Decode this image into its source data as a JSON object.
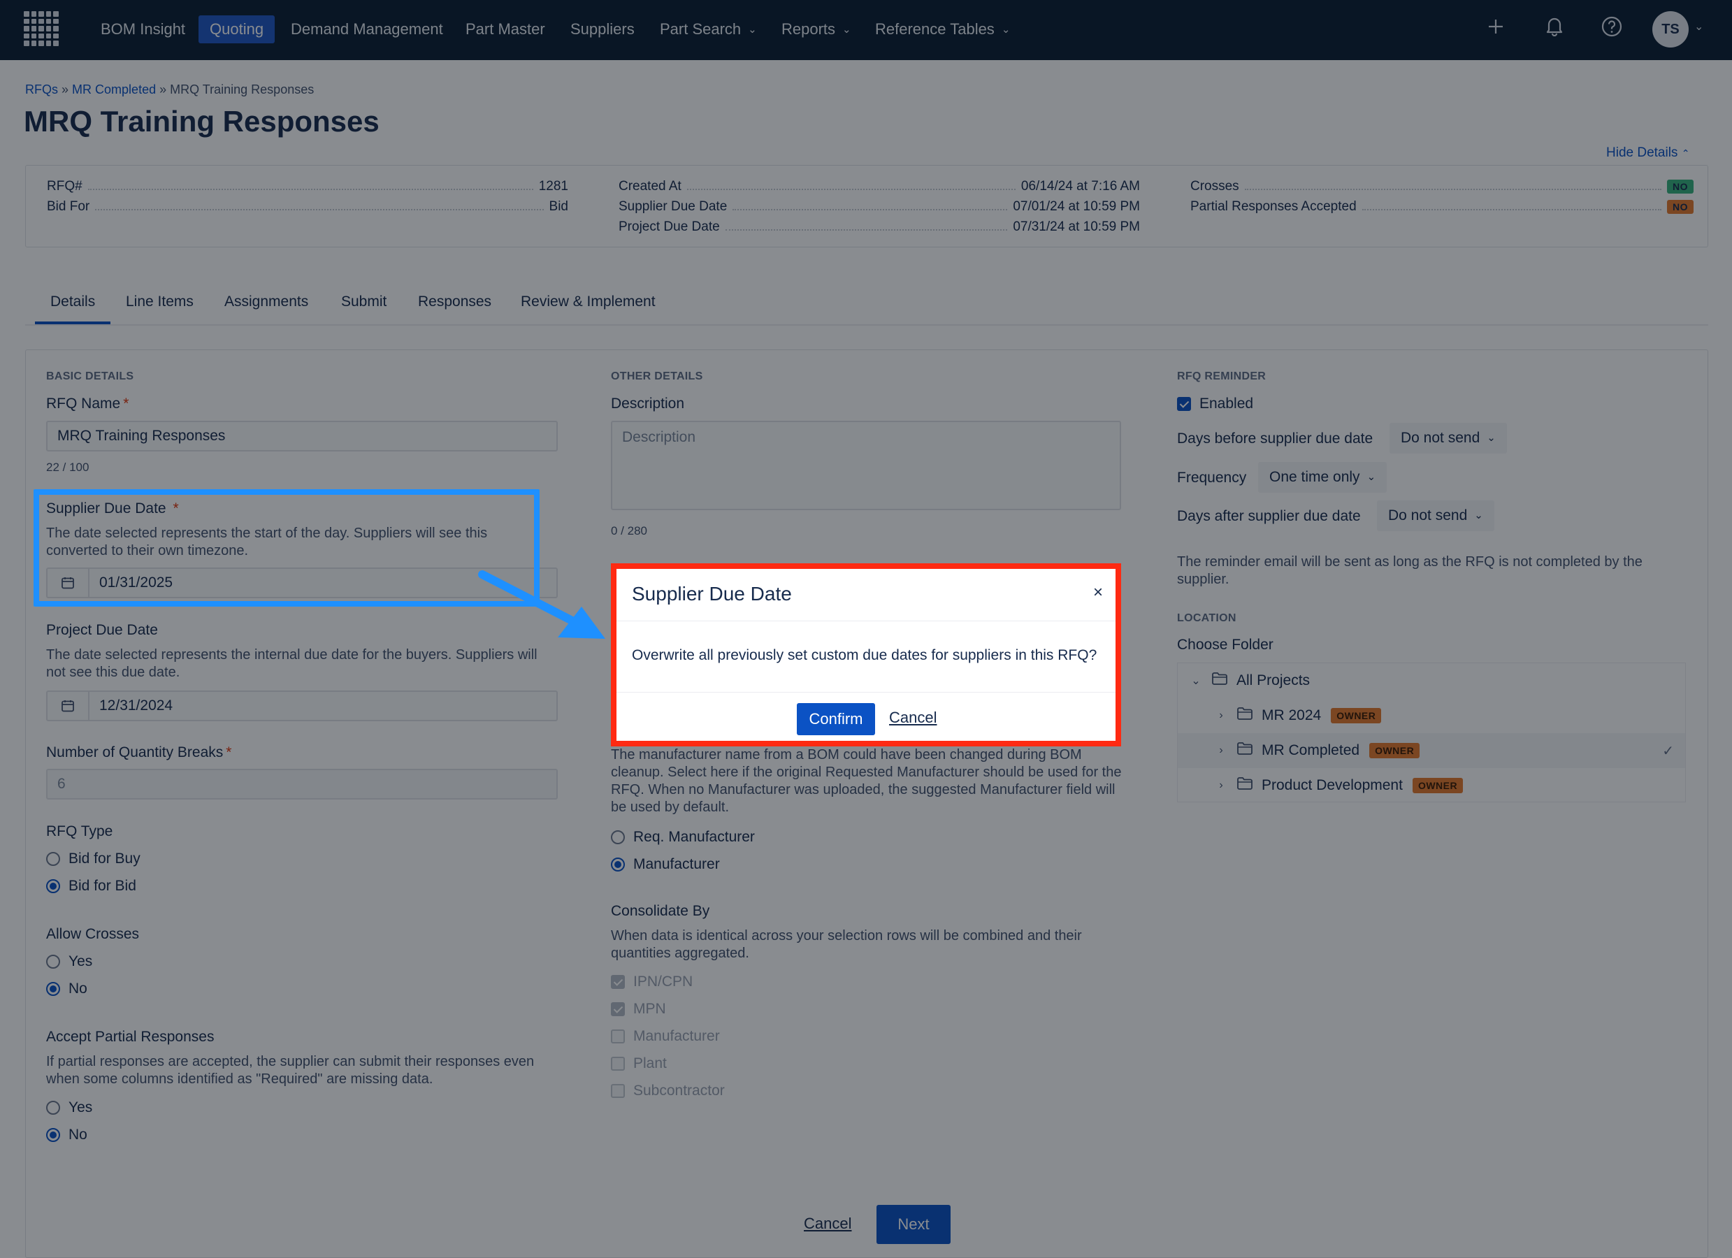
{
  "nav": {
    "items": [
      {
        "label": "BOM Insight"
      },
      {
        "label": "Quoting"
      },
      {
        "label": "Demand Management"
      },
      {
        "label": "Part Master"
      },
      {
        "label": "Suppliers"
      },
      {
        "label": "Part Search"
      },
      {
        "label": "Reports"
      },
      {
        "label": "Reference Tables"
      }
    ],
    "avatar_initials": "TS",
    "icons": [
      "app-grid-icon",
      "plus-icon",
      "bell-icon",
      "help-icon"
    ]
  },
  "breadcrumb": {
    "root": "RFQs",
    "sep": "»",
    "parent": "MR Completed",
    "current": "MRQ Training Responses"
  },
  "page_title": "MRQ Training Responses",
  "hide_details_label": "Hide Details",
  "summary": {
    "rfq_label": "RFQ#",
    "rfq_value": "1281",
    "bid_for_label": "Bid For",
    "bid_for_value": "Bid",
    "created_label": "Created At",
    "created_value": "06/14/24 at 7:16 AM",
    "supplier_due_label": "Supplier Due Date",
    "supplier_due_value": "07/01/24 at 10:59 PM",
    "project_due_label": "Project Due Date",
    "project_due_value": "07/31/24 at 10:59 PM",
    "crosses_label": "Crosses",
    "crosses_value": "NO",
    "partial_label": "Partial Responses Accepted",
    "partial_value": "NO"
  },
  "tabs": [
    "Details",
    "Line Items",
    "Assignments",
    "Submit",
    "Responses",
    "Review & Implement"
  ],
  "basic": {
    "section": "BASIC DETAILS",
    "rfq_name_label": "RFQ Name",
    "rfq_name_value": "MRQ Training Responses",
    "rfq_name_counter": "22 / 100",
    "supplier_due_label": "Supplier Due Date",
    "supplier_due_help": "The date selected represents the start of the day. Suppliers will see this converted to their own timezone.",
    "supplier_due_value": "01/31/2025",
    "project_due_label": "Project Due Date",
    "project_due_help": "The date selected represents the internal due date for the buyers. Suppliers will not see this due date.",
    "project_due_value": "12/31/2024",
    "qty_breaks_label": "Number of Quantity Breaks",
    "qty_breaks_value": "6",
    "rfq_type_label": "RFQ Type",
    "rfq_type_options": [
      "Bid for Buy",
      "Bid for Bid"
    ],
    "allow_crosses_label": "Allow Crosses",
    "yes": "Yes",
    "no": "No",
    "accept_partial_label": "Accept Partial Responses",
    "accept_partial_help": "If partial responses are accepted, the supplier can submit their responses even when some columns identified as \"Required\" are missing data."
  },
  "other": {
    "section": "OTHER DETAILS",
    "description_label": "Description",
    "description_placeholder": "Description",
    "description_counter": "0 / 280",
    "manufacturer_help": "The manufacturer name from a BOM could have been changed during BOM cleanup. Select here if the original Requested Manufacturer should be used for the RFQ. When no Manufacturer was uploaded, the suggested Manufacturer field will be used by default.",
    "manufacturer_options": [
      "Req. Manufacturer",
      "Manufacturer"
    ],
    "consolidate_label": "Consolidate By",
    "consolidate_help": "When data is identical across your selection rows will be combined and their quantities aggregated.",
    "consolidate_options": [
      "IPN/CPN",
      "MPN",
      "Manufacturer",
      "Plant",
      "Subcontractor"
    ]
  },
  "reminder": {
    "section": "RFQ REMINDER",
    "enabled_label": "Enabled",
    "days_before_label": "Days before supplier due date",
    "days_before_value": "Do not send",
    "frequency_label": "Frequency",
    "frequency_value": "One time only",
    "days_after_label": "Days after supplier due date",
    "days_after_value": "Do not send",
    "note": "The reminder email will be sent as long as the RFQ is not completed by the supplier."
  },
  "location": {
    "section": "LOCATION",
    "choose_folder_label": "Choose Folder",
    "root": "All Projects",
    "folders": [
      {
        "name": "MR 2024",
        "badge": "OWNER"
      },
      {
        "name": "MR Completed",
        "badge": "OWNER"
      },
      {
        "name": "Product Development",
        "badge": "OWNER"
      }
    ]
  },
  "footer": {
    "cancel": "Cancel",
    "next": "Next"
  },
  "modal": {
    "title": "Supplier Due Date",
    "body": "Overwrite all previously set custom due dates for suppliers in this RFQ?",
    "confirm": "Confirm",
    "cancel": "Cancel"
  },
  "colors": {
    "nav_bg": "#0b1d33",
    "primary": "#0b52c4",
    "highlight_box": "#1e90ff",
    "modal_border": "#ff2a12",
    "owner_badge": "#e57a2d",
    "no_green": "#36b37e"
  }
}
